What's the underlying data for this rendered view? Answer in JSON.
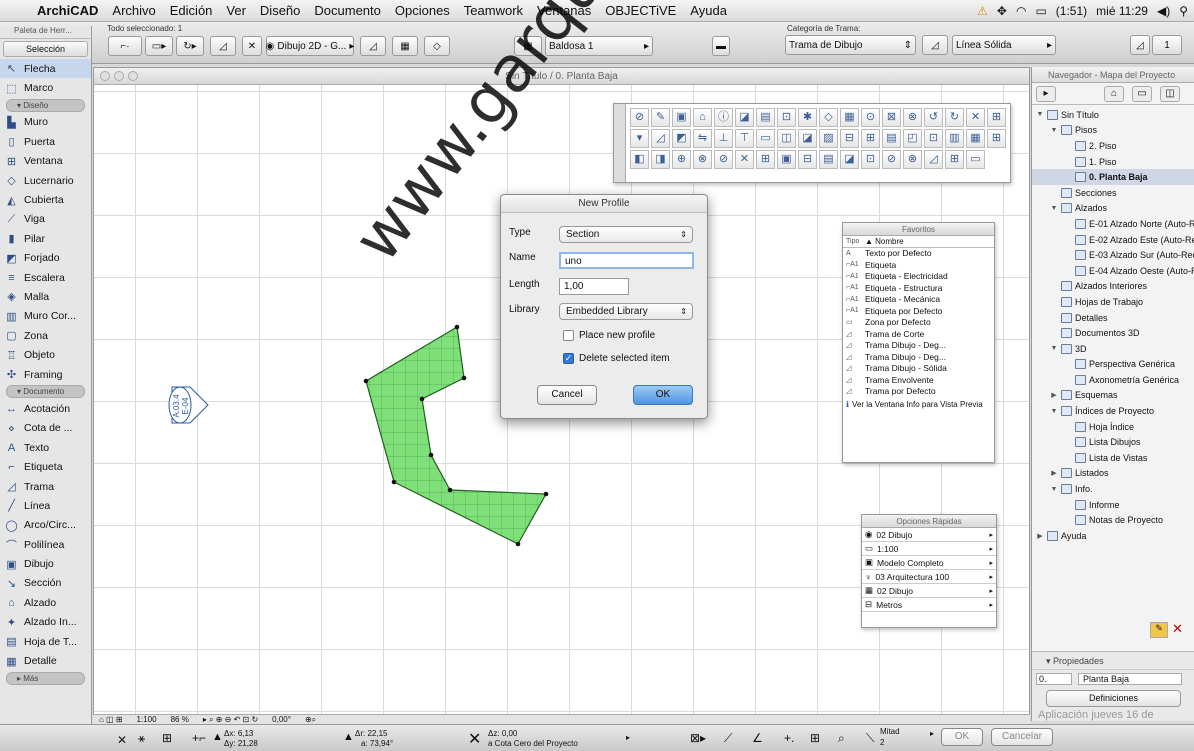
{
  "menubar": {
    "app": "ArchiCAD",
    "items": [
      "Archivo",
      "Edición",
      "Ver",
      "Diseño",
      "Documento",
      "Opciones",
      "Teamwork",
      "Ventanas",
      "OBJECTiVE",
      "Ayuda"
    ],
    "battery": "(1:51)",
    "clock": "mié 11:29"
  },
  "infobox": {
    "selected": "Todo seleccionado: 1",
    "layer": "Dibujo 2D - G...",
    "fill_name": "Baldosa 1",
    "fill_category_label": "Categoría de Trama:",
    "fill_category": "Trama de Dibujo",
    "line_type": "Línea Sólida",
    "pen": "1"
  },
  "toolbox": {
    "title": "Paleta de Herr...",
    "select_button": "Selección",
    "arrow": "Flecha",
    "marquee": "Marco",
    "group_design": "Diseño",
    "design": [
      "Muro",
      "Puerta",
      "Ventana",
      "Lucernario",
      "Cubierta",
      "Viga",
      "Pilar",
      "Forjado",
      "Escalera",
      "Malla",
      "Muro Cor...",
      "Zona",
      "Objeto",
      "Framing"
    ],
    "group_document": "Documento",
    "document": [
      "Acotación",
      "Cota de ...",
      "Texto",
      "Etiqueta",
      "Trama",
      "Línea",
      "Arco/Circ...",
      "Polilínea",
      "Dibujo",
      "Sección",
      "Alzado",
      "Alzado In...",
      "Hoja de T...",
      "Detalle"
    ],
    "more": "Más"
  },
  "window": {
    "title": "Sin Título / 0. Planta Baja",
    "marker_top": "A.03.4",
    "marker_bottom": "E-04"
  },
  "dialog": {
    "title": "New Profile",
    "type_label": "Type",
    "type_value": "Section",
    "name_label": "Name",
    "name_value": "uno",
    "length_label": "Length",
    "length_value": "1,00",
    "library_label": "Library",
    "library_value": "Embedded Library",
    "place_label": "Place new profile",
    "place_checked": false,
    "delete_label": "Delete selected item",
    "delete_checked": true,
    "cancel": "Cancel",
    "ok": "OK"
  },
  "favorites": {
    "title": "Favoritos",
    "col_type": "Tipo",
    "col_name": "▲ Nombre",
    "rows": [
      {
        "t": "A",
        "n": "Texto por Defecto"
      },
      {
        "t": "⌐A1",
        "n": "Etiqueta"
      },
      {
        "t": "⌐A1",
        "n": "Etiqueta - Electricidad"
      },
      {
        "t": "⌐A1",
        "n": "Etiqueta - Estructura"
      },
      {
        "t": "⌐A1",
        "n": "Etiqueta - Mecánica"
      },
      {
        "t": "⌐A1",
        "n": "Etiqueta por Defecto"
      },
      {
        "t": "▭",
        "n": "Zona por Defecto"
      },
      {
        "t": "◿",
        "n": "Trama de Corte"
      },
      {
        "t": "◿",
        "n": "Trama Dibujo - Deg..."
      },
      {
        "t": "◿",
        "n": "Trama Dibujo - Deg..."
      },
      {
        "t": "◿",
        "n": "Trama Dibujo - Sólida"
      },
      {
        "t": "◿",
        "n": "Trama Envolvente"
      },
      {
        "t": "◿",
        "n": "Trama por Defecto"
      }
    ],
    "note": "Ver la Ventana Info para Vista Previa"
  },
  "quick": {
    "title": "Opciones Rápidas",
    "rows": [
      "02 Dibujo",
      "1:100",
      "Modelo Completo",
      "03 Arquitectura 100",
      "02 Dibujo",
      "Metros"
    ]
  },
  "navigator": {
    "title": "Navegador - Mapa del Proyecto",
    "items": [
      {
        "label": "Sin Título",
        "level": 0,
        "tw": "▼"
      },
      {
        "label": "Pisos",
        "level": 1,
        "tw": "▼"
      },
      {
        "label": "2. Piso",
        "level": 2,
        "tw": ""
      },
      {
        "label": "1. Piso",
        "level": 2,
        "tw": ""
      },
      {
        "label": "0. Planta Baja",
        "level": 2,
        "tw": "",
        "hl": true
      },
      {
        "label": "Secciones",
        "level": 1,
        "tw": ""
      },
      {
        "label": "Alzados",
        "level": 1,
        "tw": "▼"
      },
      {
        "label": "E-01 Alzado Norte (Auto-Re",
        "level": 2,
        "tw": ""
      },
      {
        "label": "E-02 Alzado Este (Auto-Re",
        "level": 2,
        "tw": ""
      },
      {
        "label": "E-03 Alzado Sur (Auto-Rec",
        "level": 2,
        "tw": ""
      },
      {
        "label": "E-04 Alzado Oeste (Auto-R",
        "level": 2,
        "tw": ""
      },
      {
        "label": "Alzados Interiores",
        "level": 1,
        "tw": ""
      },
      {
        "label": "Hojas de Trabajo",
        "level": 1,
        "tw": ""
      },
      {
        "label": "Detalles",
        "level": 1,
        "tw": ""
      },
      {
        "label": "Documentos 3D",
        "level": 1,
        "tw": ""
      },
      {
        "label": "3D",
        "level": 1,
        "tw": "▼"
      },
      {
        "label": "Perspectiva Genérica",
        "level": 2,
        "tw": ""
      },
      {
        "label": "Axonometría Genérica",
        "level": 2,
        "tw": ""
      },
      {
        "label": "Esquemas",
        "level": 1,
        "tw": "▶"
      },
      {
        "label": "Índices de Proyecto",
        "level": 1,
        "tw": "▼"
      },
      {
        "label": "Hoja Índice",
        "level": 2,
        "tw": ""
      },
      {
        "label": "Lista Dibujos",
        "level": 2,
        "tw": ""
      },
      {
        "label": "Lista de Vistas",
        "level": 2,
        "tw": ""
      },
      {
        "label": "Listados",
        "level": 1,
        "tw": "▶"
      },
      {
        "label": "Info.",
        "level": 1,
        "tw": "▼"
      },
      {
        "label": "Informe",
        "level": 2,
        "tw": ""
      },
      {
        "label": "Notas de Proyecto",
        "level": 2,
        "tw": ""
      },
      {
        "label": "Ayuda",
        "level": 0,
        "tw": "▶"
      }
    ],
    "props_title": "Propiedades",
    "props_id": "0.",
    "props_value": "Planta Baja",
    "props_button": "Definiciones",
    "footer": "Aplicación   jueves 16 de"
  },
  "bottombar": {
    "scale": "1:100",
    "zoom": "86 %",
    "angle": "0,00°"
  },
  "coords": {
    "dx_label": "Δx:",
    "dx": "6,13",
    "dy_label": "Δy:",
    "dy": "21,28",
    "dr_label": "Δr:",
    "dr": "22,15",
    "da_label": "a:",
    "da": "73,94°",
    "dz_label": "Δz:",
    "dz": "0,00",
    "dz_ref": "a Cota Cero del Proyecto",
    "mitad": "Mitad",
    "mitad_val": "2",
    "ok": "OK",
    "cancel": "Cancelar"
  },
  "watermark": "www.garquitectos",
  "colors": {
    "fill": "#7fe07a",
    "fill_stroke": "#2a7a2a",
    "accent": "#2f7ad8",
    "grid": "#d6dbe2"
  }
}
